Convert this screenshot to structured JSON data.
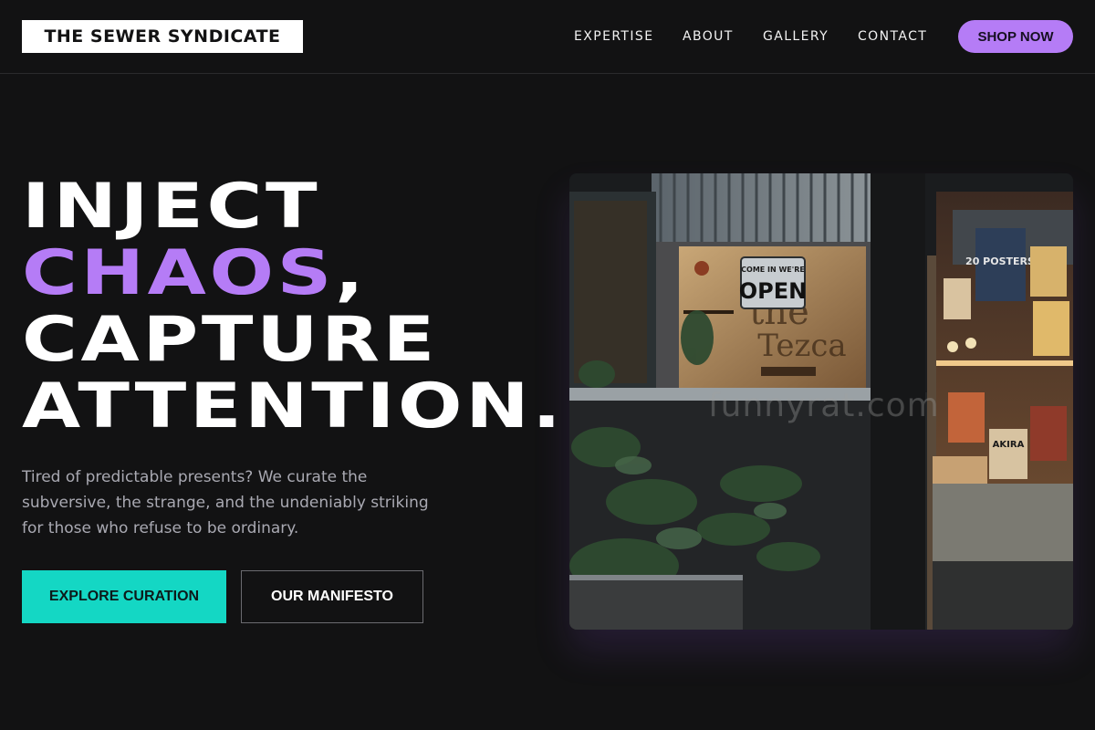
{
  "brand": {
    "name": "THE SEWER SYNDICATE"
  },
  "nav": {
    "links": [
      "EXPERTISE",
      "ABOUT",
      "GALLERY",
      "CONTACT"
    ],
    "cta": "SHOP NOW"
  },
  "hero": {
    "headline": {
      "line1": "INJECT",
      "accent": "CHAOS",
      "accent_suffix": ",",
      "line3": "CAPTURE",
      "line4": "ATTENTION."
    },
    "subtitle": "Tired of predictable presents? We curate the subversive, the strange, and the undeniably striking for those who refuse to be ordinary.",
    "primary_button": "EXPLORE CURATION",
    "secondary_button": "OUR MANIFESTO",
    "image": {
      "sign_open": "OPEN",
      "sign_top": "COME IN WE'RE",
      "poster_text": "20 POSTERS",
      "poster_text2": "AKIRA",
      "watermark": "funnyrat.com"
    }
  },
  "colors": {
    "background": "#121213",
    "accent_purple": "#b57cf6",
    "accent_teal": "#14d7c4",
    "text_muted": "#a9a9b2"
  }
}
